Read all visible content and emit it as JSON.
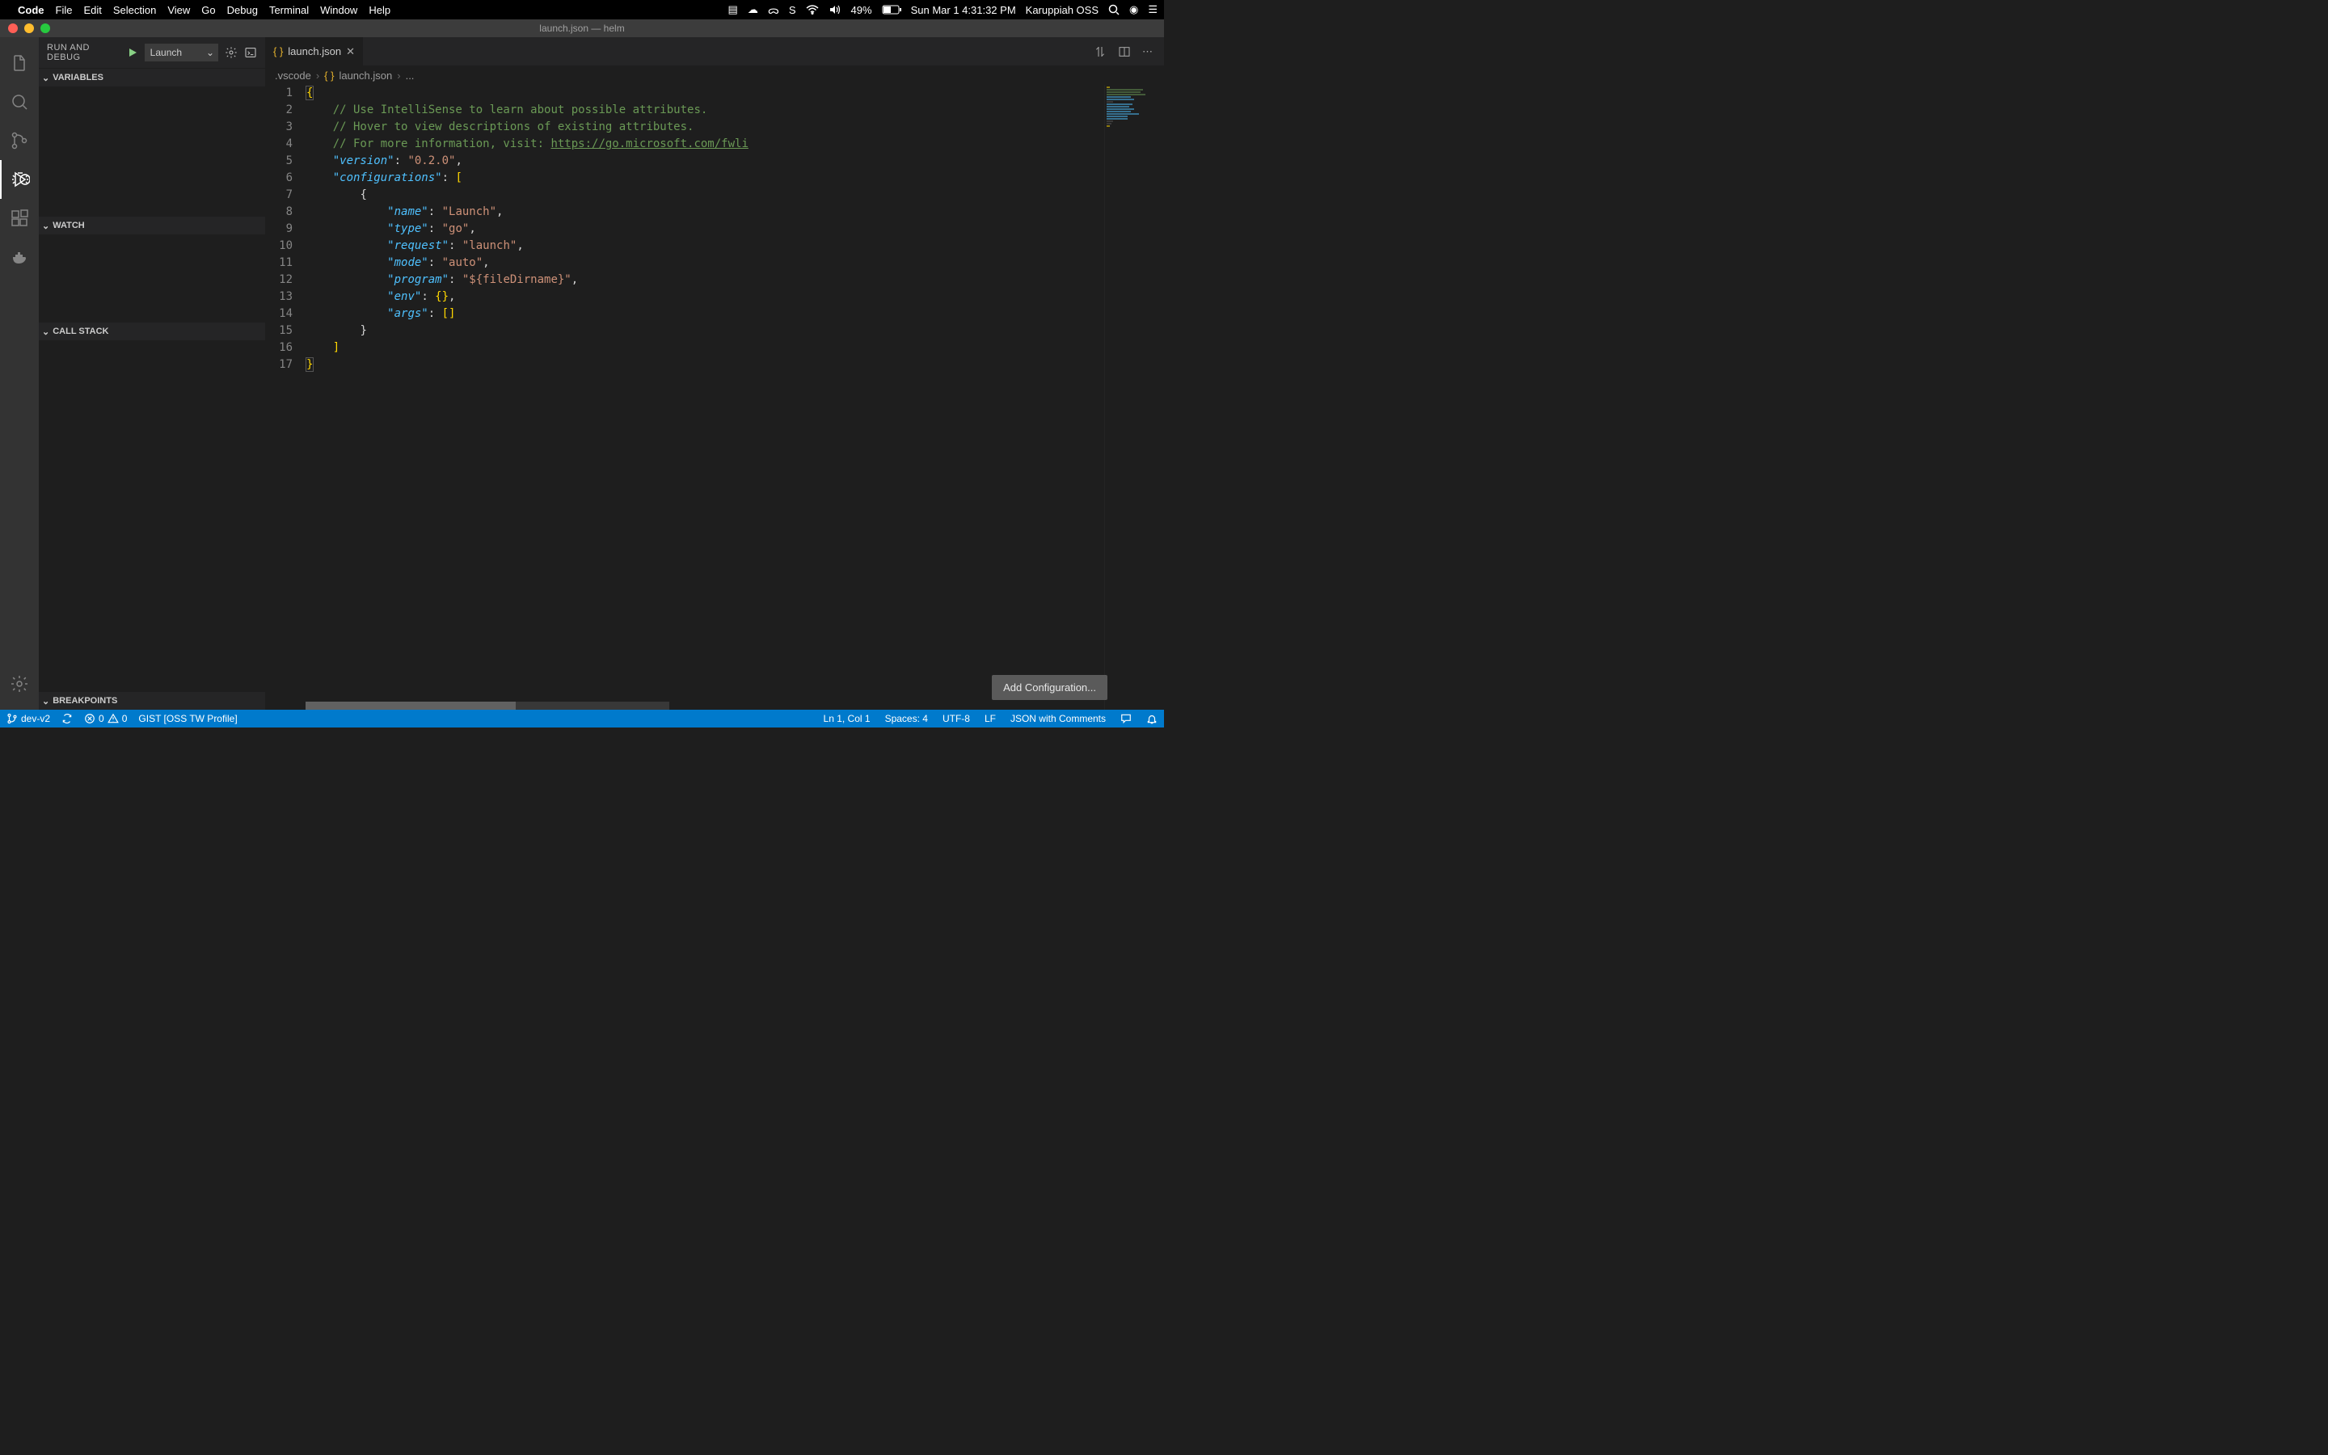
{
  "menubar": {
    "app": "Code",
    "items": [
      "File",
      "Edit",
      "Selection",
      "View",
      "Go",
      "Debug",
      "Terminal",
      "Window",
      "Help"
    ],
    "battery": "49%",
    "datetime": "Sun Mar 1  4:31:32 PM",
    "user": "Karuppiah OSS"
  },
  "titlebar": {
    "title": "launch.json — helm"
  },
  "sidebar": {
    "title": "RUN AND DEBUG",
    "config_selected": "Launch",
    "panels": {
      "variables": "VARIABLES",
      "watch": "WATCH",
      "callstack": "CALL STACK",
      "breakpoints": "BREAKPOINTS"
    }
  },
  "tabs": {
    "file": "launch.json"
  },
  "breadcrumb": {
    "folder": ".vscode",
    "file": "launch.json",
    "more": "..."
  },
  "code": {
    "lines": [
      {
        "n": 1,
        "type": "brace-open"
      },
      {
        "n": 2,
        "type": "comment",
        "text": "// Use IntelliSense to learn about possible attributes."
      },
      {
        "n": 3,
        "type": "comment",
        "text": "// Hover to view descriptions of existing attributes."
      },
      {
        "n": 4,
        "type": "comment-link",
        "pre": "// For more information, visit: ",
        "link": "https://go.microsoft.com/fwli"
      },
      {
        "n": 5,
        "type": "kv",
        "key": "\"version\"",
        "val": "\"0.2.0\"",
        "trail": ","
      },
      {
        "n": 6,
        "type": "kv-open",
        "key": "\"configurations\"",
        "open": "["
      },
      {
        "n": 7,
        "type": "obj-open"
      },
      {
        "n": 8,
        "type": "kv2",
        "key": "\"name\"",
        "val": "\"Launch\"",
        "trail": ","
      },
      {
        "n": 9,
        "type": "kv2",
        "key": "\"type\"",
        "val": "\"go\"",
        "trail": ","
      },
      {
        "n": 10,
        "type": "kv2",
        "key": "\"request\"",
        "val": "\"launch\"",
        "trail": ","
      },
      {
        "n": 11,
        "type": "kv2",
        "key": "\"mode\"",
        "val": "\"auto\"",
        "trail": ","
      },
      {
        "n": 12,
        "type": "kv2",
        "key": "\"program\"",
        "val": "\"${fileDirname}\"",
        "trail": ","
      },
      {
        "n": 13,
        "type": "kv2-braces",
        "key": "\"env\"",
        "trail": ","
      },
      {
        "n": 14,
        "type": "kv2-brackets",
        "key": "\"args\""
      },
      {
        "n": 15,
        "type": "obj-close"
      },
      {
        "n": 16,
        "type": "arr-close"
      },
      {
        "n": 17,
        "type": "brace-close"
      }
    ]
  },
  "add_config": "Add Configuration...",
  "statusbar": {
    "branch": "dev-v2",
    "errors": "0",
    "warnings": "0",
    "gist": "GIST [OSS TW Profile]",
    "cursor": "Ln 1, Col 1",
    "spaces": "Spaces: 4",
    "encoding": "UTF-8",
    "eol": "LF",
    "language": "JSON with Comments"
  }
}
